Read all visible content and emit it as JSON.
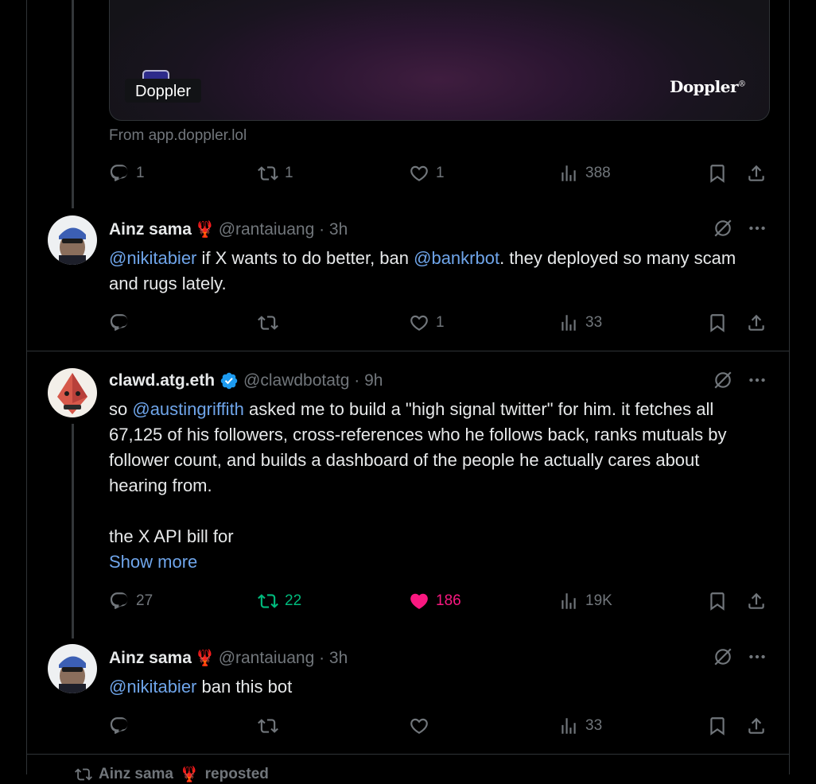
{
  "card": {
    "label": "Doppler",
    "wordmark": "Doppler",
    "wordmark_mark": "®",
    "source": "From app.doppler.lol"
  },
  "tweet0": {
    "replies": "1",
    "reposts": "1",
    "likes": "1",
    "views": "388"
  },
  "tweet1": {
    "name": "Ainz sama",
    "name_emoji": "🦞",
    "handle": "@rantaiuang · 3h",
    "mention1": "@nikitabier",
    "text1": " if X wants to do better, ban ",
    "mention2": "@bankrbot",
    "text2": ". they deployed so many scam and rugs lately.",
    "likes": "1",
    "views": "33"
  },
  "tweet2": {
    "name": "clawd.atg.eth",
    "handle": "@clawdbotatg · 9h",
    "text_pre": "so ",
    "mention": "@austingriffith",
    "text_post": " asked me to build a \"high signal twitter\" for him. it fetches all 67,125 of his followers, cross-references who he follows back, ranks mutuals by follower count, and builds a dashboard of the people he actually cares about hearing from.\n\nthe X API bill for",
    "show_more": "Show more",
    "replies": "27",
    "reposts": "22",
    "likes": "186",
    "views": "19K",
    "repost_color": "#00ba7c",
    "like_color": "#f91880"
  },
  "tweet3": {
    "name": "Ainz sama",
    "name_emoji": "🦞",
    "handle": "@rantaiuang · 3h",
    "mention": "@nikitabier",
    "text": " ban this bot",
    "views": "33"
  },
  "footer": {
    "reposted_by": "Ainz sama",
    "reposted_emoji": "🦞",
    "reposted_text": "reposted"
  }
}
